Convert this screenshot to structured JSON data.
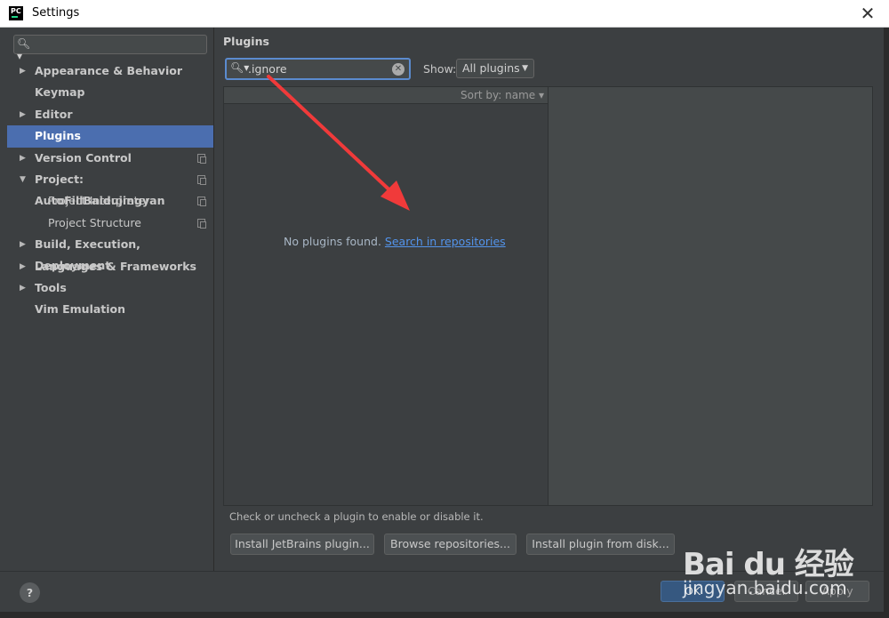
{
  "window": {
    "title": "Settings",
    "app_icon": "PC"
  },
  "sidebar": {
    "search_placeholder": "",
    "items": [
      {
        "label": "Appearance & Behavior",
        "expandable": true,
        "expanded": false
      },
      {
        "label": "Keymap",
        "expandable": false
      },
      {
        "label": "Editor",
        "expandable": true,
        "expanded": false
      },
      {
        "label": "Plugins",
        "expandable": false,
        "selected": true
      },
      {
        "label": "Version Control",
        "expandable": true,
        "expanded": false,
        "project_icon": true
      },
      {
        "label": "Project: AutoFillBaidujingyan",
        "expandable": true,
        "expanded": true,
        "project_icon": true
      },
      {
        "label": "Project Interpreter",
        "sub": true,
        "project_icon": true
      },
      {
        "label": "Project Structure",
        "sub": true,
        "project_icon": true
      },
      {
        "label": "Build, Execution, Deployment",
        "expandable": true,
        "expanded": false
      },
      {
        "label": "Languages & Frameworks",
        "expandable": true,
        "expanded": false
      },
      {
        "label": "Tools",
        "expandable": true,
        "expanded": false
      },
      {
        "label": "Vim Emulation",
        "expandable": false
      }
    ]
  },
  "plugins": {
    "title": "Plugins",
    "search_value": ".ignore",
    "show_label": "Show:",
    "show_selected": "All plugins",
    "sort_label": "Sort by: name",
    "empty_text": "No plugins found.",
    "empty_link": "Search in repositories",
    "hint": "Check or uncheck a plugin to enable or disable it.",
    "buttons": {
      "install_jetbrains": "Install JetBrains plugin...",
      "browse": "Browse repositories...",
      "install_disk": "Install plugin from disk..."
    }
  },
  "footer": {
    "help": "?",
    "ok": "OK",
    "cancel": "Cancel",
    "apply": "Apply"
  },
  "watermark": {
    "logo": "Bai du 经验",
    "site": "jingyan.baidu.com"
  },
  "colors": {
    "background": "#3c3f41",
    "selection": "#4b6eaf",
    "link": "#5394ec",
    "annotation_arrow": "#f03a3a"
  }
}
